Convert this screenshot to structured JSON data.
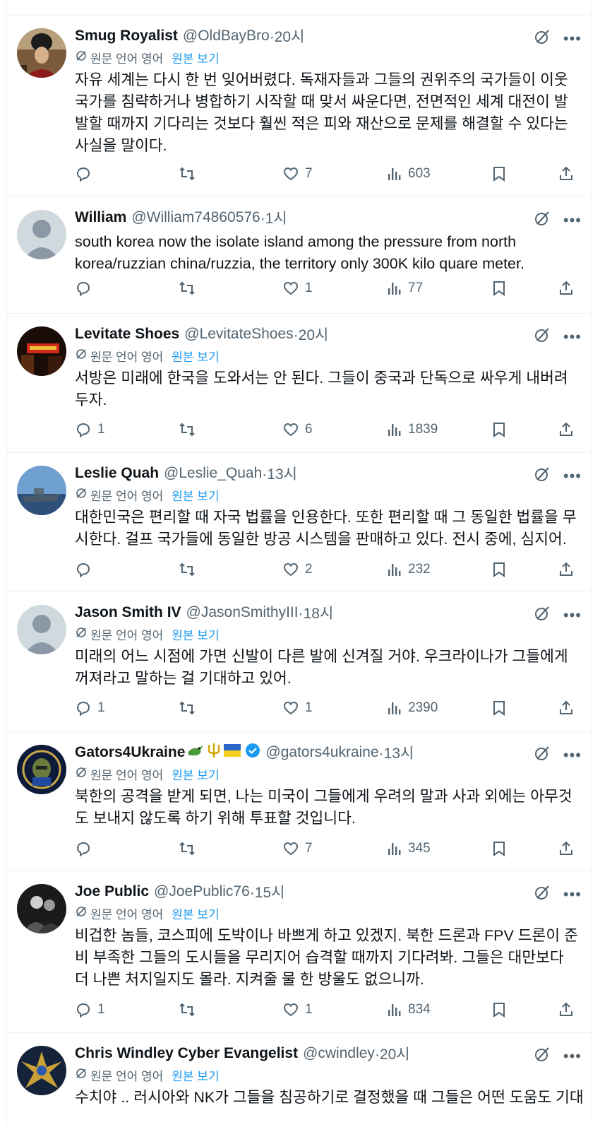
{
  "translate_label": "원문 언어 영어",
  "show_original_label": "원본 보기",
  "tweets": [
    {
      "name": "Smug Royalist",
      "handle": "@OldBayBro",
      "time": "·20시",
      "translated": true,
      "text": "자유 세계는 다시 한 번 잊어버렸다. 독재자들과 그들의 권위주의 국가들이 이웃 국가를 침략하거나 병합하기 시작할 때 맞서 싸운다면, 전면적인 세계 대전이 발발할 때까지 기다리는 것보다 훨씬 적은 피와 재산으로 문제를 해결할 수 있다는 사실을 말이다.",
      "replies": "",
      "likes": "7",
      "views": "603",
      "avatar": "smug-royalist"
    },
    {
      "name": "William",
      "handle": "@William74860576",
      "time": "·1시",
      "translated": false,
      "text": "south korea now the isolate island among the pressure from north korea/ruzzian china/ruzzia, the territory only 300K kilo quare meter.",
      "replies": "",
      "likes": "1",
      "views": "77",
      "avatar": "default"
    },
    {
      "name": "Levitate Shoes",
      "handle": "@LevitateShoes",
      "time": "·20시",
      "translated": true,
      "text": "서방은 미래에 한국을 도와서는 안 된다. 그들이 중국과 단독으로 싸우게 내버려 두자.",
      "replies": "1",
      "likes": "6",
      "views": "1839",
      "avatar": "levitate"
    },
    {
      "name": "Leslie Quah",
      "handle": "@Leslie_Quah",
      "time": "·13시",
      "translated": true,
      "text": "대한민국은 편리할 때 자국 법률을 인용한다. 또한 편리할 때 그 동일한 법률을 무시한다. 걸프 국가들에 동일한 방공 시스템을 판매하고 있다. 전시 중에, 심지어.",
      "replies": "",
      "likes": "2",
      "views": "232",
      "avatar": "leslie"
    },
    {
      "name": "Jason Smith IV",
      "handle": "@JasonSmithyIII",
      "time": "·18시",
      "translated": true,
      "text": "미래의 어느 시점에 가면 신발이 다른 발에 신겨질 거야. 우크라이나가 그들에게 꺼져라고 말하는 걸 기대하고 있어.",
      "replies": "1",
      "likes": "1",
      "views": "2390",
      "avatar": "default"
    },
    {
      "name": "Gators4Ukraine",
      "handle": "@gators4ukraine",
      "time": "·13시",
      "translated": true,
      "verified": true,
      "text": "북한의 공격을 받게 되면, 나는 미국이 그들에게 우려의 말과 사과 외에는 아무것도 보내지 않도록 하기 위해 투표할 것입니다.",
      "replies": "",
      "likes": "7",
      "views": "345",
      "avatar": "gators"
    },
    {
      "name": "Joe Public",
      "handle": "@JoePublic76",
      "time": "·15시",
      "translated": true,
      "text": "비겁한 놈들, 코스피에 도박이나 바쁘게 하고 있겠지. 북한 드론과 FPV 드론이 준비 부족한 그들의 도시들을 무리지어 습격할 때까지 기다려봐. 그들은 대만보다 더 나쁜 처지일지도 몰라. 지켜줄 물 한 방울도 없으니까.",
      "replies": "1",
      "likes": "1",
      "views": "834",
      "avatar": "joe"
    },
    {
      "name": "Chris Windley Cyber Evangelist",
      "handle": "@cwindley",
      "time": "·20시",
      "translated": true,
      "text": "수치야 .. 러시아와 NK가 그들을 침공하기로 결정했을 때 그들은 어떤 도움도 기대",
      "replies": "",
      "likes": "",
      "views": "",
      "avatar": "chris"
    }
  ]
}
